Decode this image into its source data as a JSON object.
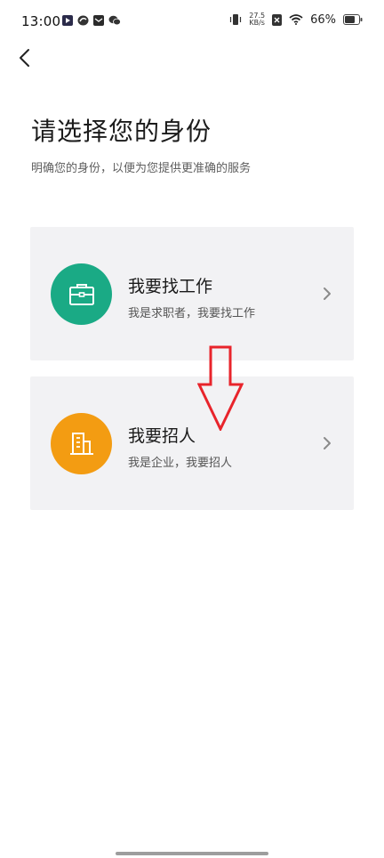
{
  "status_bar": {
    "time": "13:00",
    "left_icons": [
      "play-store-icon",
      "sync-icon",
      "mail-icon",
      "wechat-icon"
    ],
    "net_speed_value": "27.5",
    "net_speed_unit": "KB/s",
    "battery": "66%"
  },
  "header": {
    "back_icon": "back-arrow-icon"
  },
  "page": {
    "title": "请选择您的身份",
    "subtitle": "明确您的身份，以便为您提供更准确的服务"
  },
  "cards": [
    {
      "title": "我要找工作",
      "description": "我是求职者，我要找工作",
      "icon": "briefcase-icon",
      "color": "#1aaa85"
    },
    {
      "title": "我要招人",
      "description": "我是企业，我要招人",
      "icon": "building-icon",
      "color": "#f39c12"
    }
  ],
  "colors": {
    "card_background": "#f2f2f4",
    "annotation": "#e8242b",
    "chevron": "#8a8a8a"
  }
}
